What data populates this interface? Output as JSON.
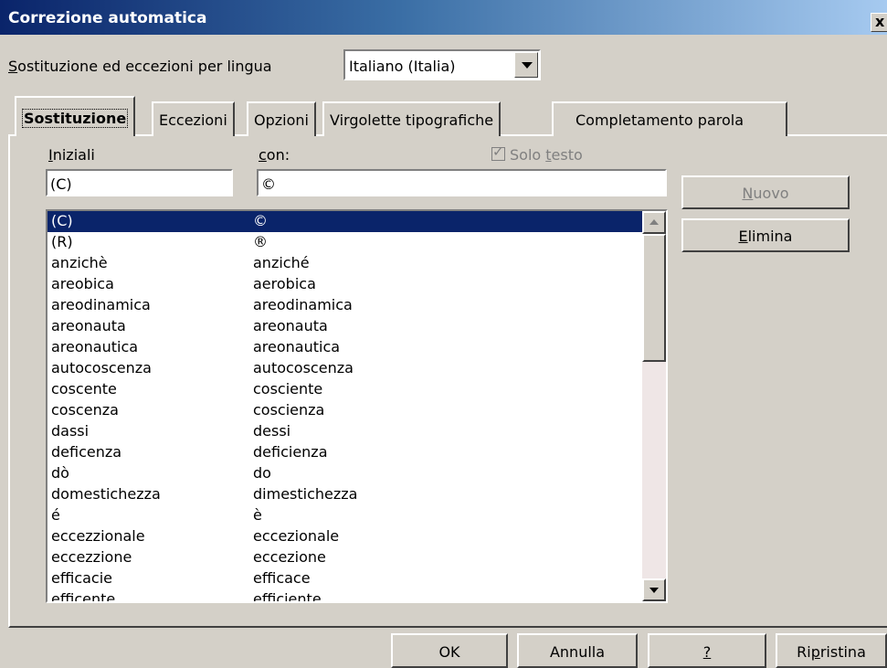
{
  "window": {
    "title": "Correzione automatica",
    "close_label": "x"
  },
  "language": {
    "label_first": "S",
    "label_rest": "ostituzione ed eccezioni per lingua",
    "selected": "Italiano (Italia)"
  },
  "tabs": [
    {
      "label": "Sostituzione"
    },
    {
      "label": "Eccezioni"
    },
    {
      "label": "Opzioni"
    },
    {
      "label": "Virgolette tipografiche"
    },
    {
      "label": "Completamento parola"
    }
  ],
  "fields": {
    "iniziali_first": "I",
    "iniziali_rest": "niziali",
    "con_first": "c",
    "con_rest": "on:",
    "solo_testo_pre": "Solo ",
    "solo_testo_key": "t",
    "solo_testo_post": "esto",
    "iniziali_value": "(C)",
    "con_value": "©"
  },
  "buttons": {
    "nuovo_key": "N",
    "nuovo_rest": "uovo",
    "elimina_key": "E",
    "elimina_rest": "limina",
    "ok": "OK",
    "annulla": "Annulla",
    "help": "?",
    "ripristina_pre": "Ri",
    "ripristina_key": "p",
    "ripristina_post": "ristina"
  },
  "replacement_list": [
    {
      "from": "(C)",
      "to": "©",
      "selected": true
    },
    {
      "from": "(R)",
      "to": "®"
    },
    {
      "from": "anzichè",
      "to": "anziché"
    },
    {
      "from": "areobica",
      "to": "aerobica"
    },
    {
      "from": "areodinamica",
      "to": "areodinamica"
    },
    {
      "from": "areonauta",
      "to": "areonauta"
    },
    {
      "from": "areonautica",
      "to": "areonautica"
    },
    {
      "from": "autocoscenza",
      "to": "autocoscenza"
    },
    {
      "from": "coscente",
      "to": "cosciente"
    },
    {
      "from": "coscenza",
      "to": "coscienza"
    },
    {
      "from": "dassi",
      "to": "dessi"
    },
    {
      "from": "deficenza",
      "to": "deficienza"
    },
    {
      "from": "dò",
      "to": "do"
    },
    {
      "from": "domestichezza",
      "to": "dimestichezza"
    },
    {
      "from": "é",
      "to": "è"
    },
    {
      "from": "eccezzionale",
      "to": "eccezionale"
    },
    {
      "from": "eccezzione",
      "to": "eccezione"
    },
    {
      "from": "efficacie",
      "to": "efficace"
    },
    {
      "from": "efficente",
      "to": "efficiente"
    }
  ],
  "icons": {
    "dropdown": "chevron-down-icon",
    "scroll_up": "arrow-up-icon",
    "scroll_down": "arrow-down-icon",
    "checkbox": "checkbox-checked-icon"
  },
  "colors": {
    "title_gradient_start": "#0a246a",
    "title_gradient_end": "#a6caf0",
    "selection": "#0a246a",
    "dialog_bg": "#d4d0c8"
  }
}
